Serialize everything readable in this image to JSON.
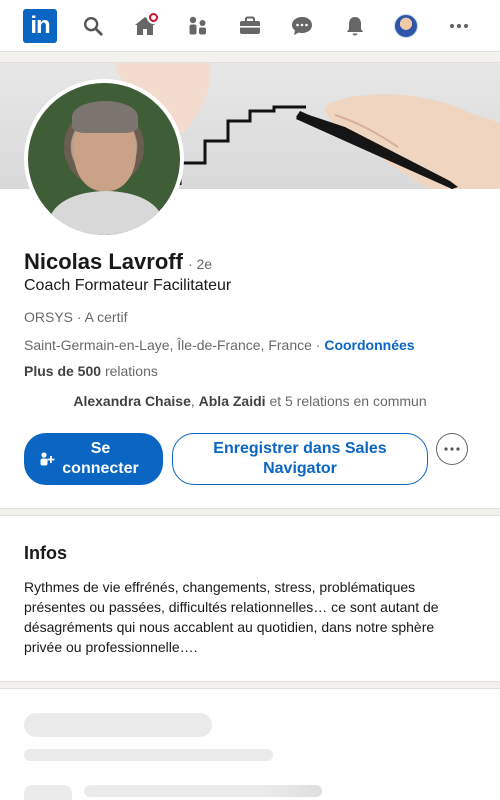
{
  "nav": {
    "logo_text": "in",
    "items": [
      {
        "name": "search-icon"
      },
      {
        "name": "home-icon",
        "badge": true
      },
      {
        "name": "network-icon"
      },
      {
        "name": "jobs-icon"
      },
      {
        "name": "messaging-icon"
      },
      {
        "name": "notifications-icon"
      },
      {
        "name": "me-avatar"
      },
      {
        "name": "more-icon"
      }
    ],
    "accent": "#0a66c2",
    "badge_color": "#cb112d"
  },
  "profile": {
    "name": "Nicolas Lavroff",
    "degree": "· 2e",
    "headline": "Coach Formateur Facilitateur",
    "company": "ORSYS · A certif",
    "location": "Saint-Germain-en-Laye, Île-de-France, France ·",
    "contact_link": "Coordonnées",
    "connections_count": "Plus de 500",
    "connections_label": "relations",
    "mutual": {
      "name1": "Alexandra Chaise",
      "sep": ",",
      "name2": "Abla Zaidi",
      "rest": "et 5 relations en commun"
    },
    "connect_label": "Se connecter",
    "sales_nav_label": "Enregistrer dans Sales Navigator"
  },
  "infos": {
    "title": "Infos",
    "text": "Rythmes de vie effrénés, changements, stress, problématiques présentes ou passées, difficultés relationnelles… ce sont autant de désagréments qui nous accablent au quotidien, dans notre sphère privée ou professionnelle…."
  }
}
